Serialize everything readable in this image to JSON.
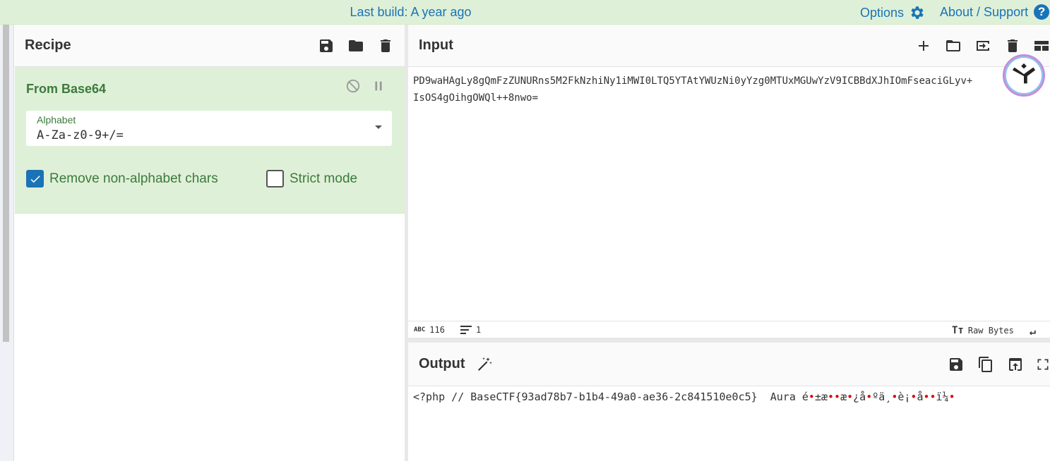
{
  "topbar": {
    "build": "Last build: A year ago",
    "options": "Options",
    "about": "About / Support"
  },
  "recipe": {
    "title": "Recipe",
    "operation": {
      "name": "From Base64",
      "alphabet_label": "Alphabet",
      "alphabet_value": "A-Za-z0-9+/=",
      "remove_nonalpha_label": "Remove non-alphabet chars",
      "remove_nonalpha_checked": true,
      "strict_label": "Strict mode",
      "strict_checked": false
    }
  },
  "input": {
    "title": "Input",
    "line1": "PD9waHAgLy8gQmFzZUNURns5M2FkNzhiNy1iMWI0LTQ5YTAtYWUzNi0yYzg0MTUxMGUwYzV9ICBBdXJhIOmFseaciGLyv+",
    "line2": "IsOS4gOihgOWQl++8nwo=",
    "status": {
      "chars": "116",
      "lines": "1",
      "encoding": "Raw Bytes"
    }
  },
  "output": {
    "title": "Output",
    "text_prefix": "<?php // BaseCTF{93ad78b7-b1b4-49a0-ae36-2c841510e0c5}  Aura é",
    "text_rest": [
      "±æ",
      "æ",
      "¿å",
      "ºä¸",
      "è¡",
      "å",
      "ï¼",
      ""
    ]
  },
  "colors": {
    "topbar_bg": "#dff0d8",
    "accent": "#1a73b6",
    "op_green": "#3c7a3c"
  }
}
